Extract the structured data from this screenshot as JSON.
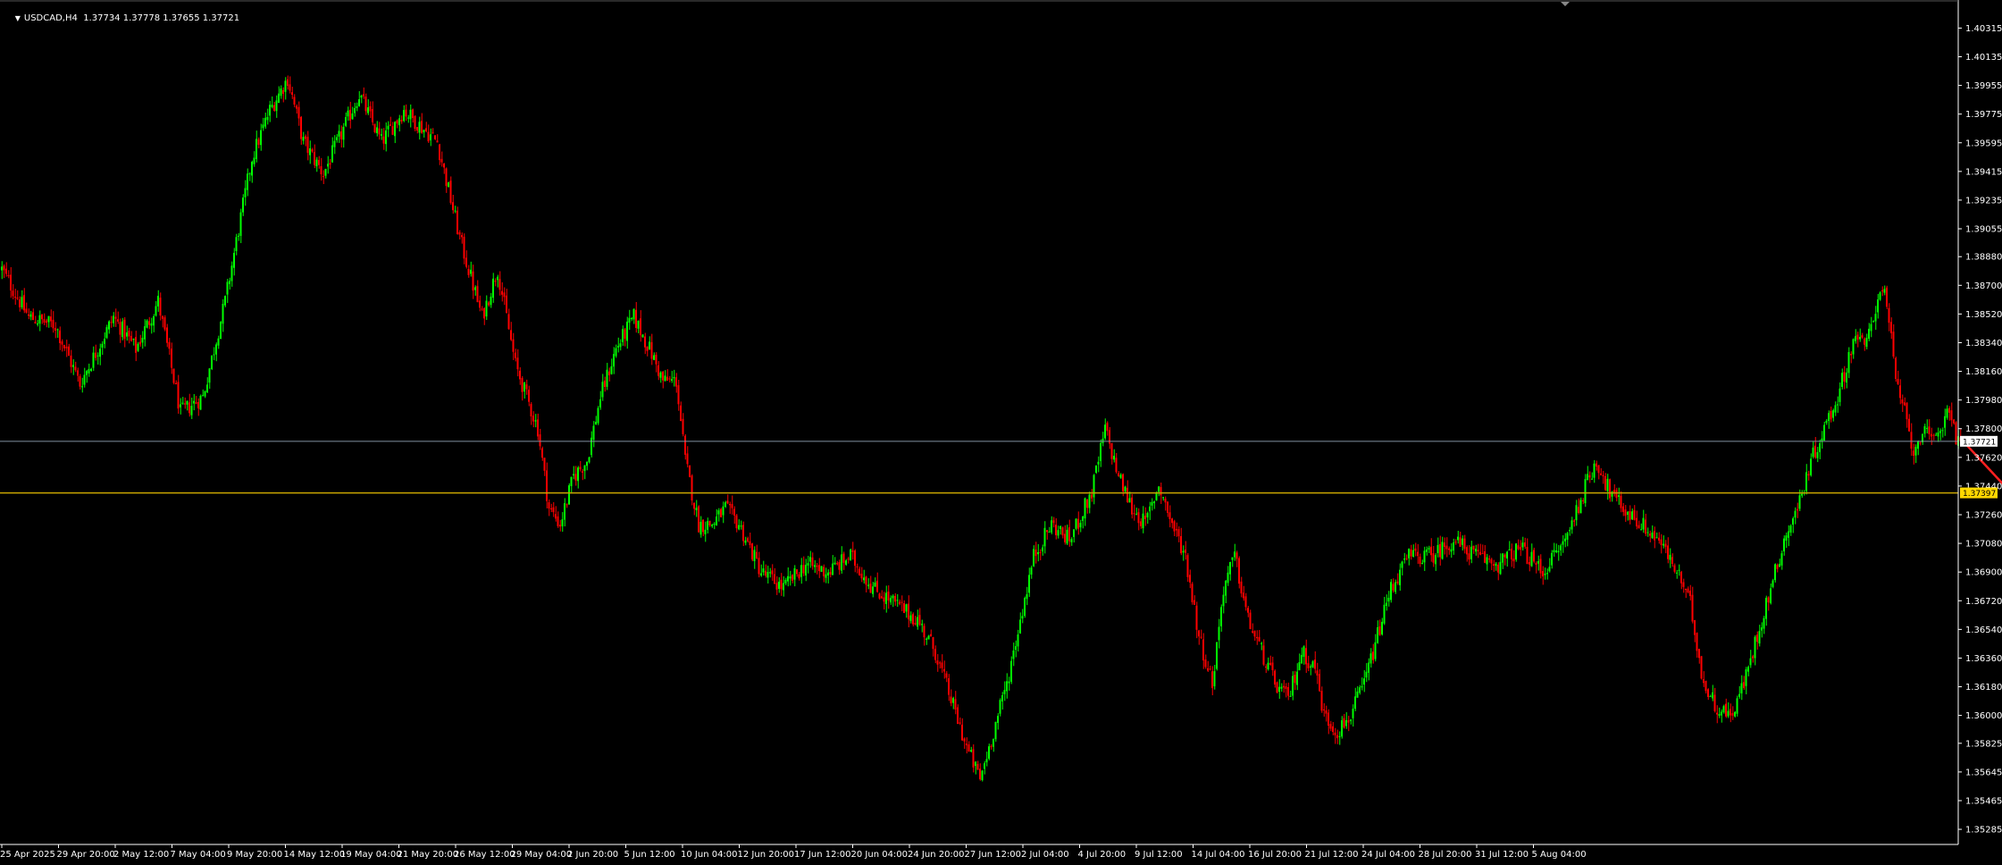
{
  "header": {
    "symbol": "USDCAD,H4",
    "ohlc": "1.37734 1.37778 1.37655 1.37721"
  },
  "colors": {
    "background": "#000000",
    "bull": "#00ff00",
    "bear": "#ff0000",
    "axis": "#ffffff",
    "current_line": "#8090a0",
    "support_line": "#c8a400",
    "projection": "#ff2020",
    "current_label_bg": "#ffffff",
    "support_label_bg": "#ffd700"
  },
  "chart_data": {
    "type": "candlestick",
    "symbol": "USDCAD",
    "timeframe": "H4",
    "ylim": [
      1.3519,
      1.4048
    ],
    "y_ticks": [
      "1.40315",
      "1.40135",
      "1.39955",
      "1.39775",
      "1.39595",
      "1.39415",
      "1.39235",
      "1.39055",
      "1.38880",
      "1.38700",
      "1.38520",
      "1.38340",
      "1.38160",
      "1.37980",
      "1.37800",
      "1.37620",
      "1.37440",
      "1.37260",
      "1.37080",
      "1.36900",
      "1.36720",
      "1.36540",
      "1.36360",
      "1.36180",
      "1.36000",
      "1.35825",
      "1.35645",
      "1.35465",
      "1.35285"
    ],
    "x_ticks": [
      "25 Apr 2025",
      "29 Apr 20:00",
      "2 May 12:00",
      "7 May 04:00",
      "9 May 20:00",
      "14 May 12:00",
      "19 May 04:00",
      "21 May 20:00",
      "26 May 12:00",
      "29 May 04:00",
      "2 Jun 20:00",
      "5 Jun 12:00",
      "10 Jun 04:00",
      "12 Jun 20:00",
      "17 Jun 12:00",
      "20 Jun 04:00",
      "24 Jun 20:00",
      "27 Jun 12:00",
      "2 Jul 04:00",
      "4 Jul 20:00",
      "9 Jul 12:00",
      "14 Jul 04:00",
      "16 Jul 20:00",
      "21 Jul 12:00",
      "24 Jul 04:00",
      "28 Jul 20:00",
      "31 Jul 12:00",
      "5 Aug 04:00"
    ],
    "anchors": [
      [
        0,
        1.388
      ],
      [
        12,
        1.385
      ],
      [
        24,
        1.3845
      ],
      [
        35,
        1.3808
      ],
      [
        50,
        1.385
      ],
      [
        60,
        1.383
      ],
      [
        70,
        1.386
      ],
      [
        80,
        1.379
      ],
      [
        90,
        1.38
      ],
      [
        100,
        1.386
      ],
      [
        108,
        1.392
      ],
      [
        112,
        1.395
      ],
      [
        120,
        1.398
      ],
      [
        128,
        1.4
      ],
      [
        135,
        1.396
      ],
      [
        144,
        1.394
      ],
      [
        160,
        1.399
      ],
      [
        170,
        1.396
      ],
      [
        180,
        1.398
      ],
      [
        195,
        1.396
      ],
      [
        205,
        1.39
      ],
      [
        215,
        1.385
      ],
      [
        222,
        1.388
      ],
      [
        230,
        1.382
      ],
      [
        240,
        1.378
      ],
      [
        245,
        1.373
      ],
      [
        250,
        1.372
      ],
      [
        256,
        1.375
      ],
      [
        262,
        1.376
      ],
      [
        268,
        1.38
      ],
      [
        275,
        1.383
      ],
      [
        283,
        1.385
      ],
      [
        290,
        1.383
      ],
      [
        296,
        1.381
      ],
      [
        302,
        1.381
      ],
      [
        306,
        1.376
      ],
      [
        312,
        1.372
      ],
      [
        318,
        1.372
      ],
      [
        324,
        1.373
      ],
      [
        330,
        1.372
      ],
      [
        340,
        1.369
      ],
      [
        350,
        1.368
      ],
      [
        360,
        1.3695
      ],
      [
        370,
        1.369
      ],
      [
        380,
        1.37
      ],
      [
        390,
        1.368
      ],
      [
        400,
        1.367
      ],
      [
        410,
        1.366
      ],
      [
        418,
        1.364
      ],
      [
        425,
        1.361
      ],
      [
        432,
        1.358
      ],
      [
        438,
        1.356
      ],
      [
        444,
        1.359
      ],
      [
        450,
        1.362
      ],
      [
        456,
        1.366
      ],
      [
        462,
        1.37
      ],
      [
        470,
        1.372
      ],
      [
        478,
        1.371
      ],
      [
        488,
        1.374
      ],
      [
        494,
        1.378
      ],
      [
        500,
        1.375
      ],
      [
        506,
        1.373
      ],
      [
        512,
        1.372
      ],
      [
        518,
        1.3745
      ],
      [
        524,
        1.372
      ],
      [
        530,
        1.37
      ],
      [
        536,
        1.365
      ],
      [
        542,
        1.362
      ],
      [
        547,
        1.368
      ],
      [
        552,
        1.37
      ],
      [
        558,
        1.366
      ],
      [
        564,
        1.364
      ],
      [
        570,
        1.362
      ],
      [
        576,
        1.361
      ],
      [
        582,
        1.364
      ],
      [
        588,
        1.363
      ],
      [
        592,
        1.36
      ],
      [
        598,
        1.359
      ],
      [
        604,
        1.36
      ],
      [
        610,
        1.362
      ],
      [
        616,
        1.365
      ],
      [
        622,
        1.368
      ],
      [
        630,
        1.37
      ],
      [
        640,
        1.37
      ],
      [
        650,
        1.371
      ],
      [
        660,
        1.37
      ],
      [
        670,
        1.3695
      ],
      [
        680,
        1.3705
      ],
      [
        690,
        1.369
      ],
      [
        700,
        1.371
      ],
      [
        708,
        1.374
      ],
      [
        714,
        1.376
      ],
      [
        720,
        1.374
      ],
      [
        726,
        1.373
      ],
      [
        734,
        1.372
      ],
      [
        742,
        1.371
      ],
      [
        750,
        1.369
      ],
      [
        756,
        1.367
      ],
      [
        762,
        1.362
      ],
      [
        768,
        1.3605
      ],
      [
        774,
        1.36
      ],
      [
        780,
        1.362
      ],
      [
        786,
        1.365
      ],
      [
        792,
        1.368
      ],
      [
        798,
        1.371
      ],
      [
        804,
        1.373
      ],
      [
        810,
        1.376
      ],
      [
        816,
        1.378
      ],
      [
        822,
        1.38
      ],
      [
        826,
        1.382
      ],
      [
        830,
        1.384
      ],
      [
        834,
        1.383
      ],
      [
        838,
        1.385
      ],
      [
        841,
        1.387
      ],
      [
        844,
        1.386
      ],
      [
        848,
        1.381
      ],
      [
        852,
        1.379
      ],
      [
        856,
        1.3765
      ],
      [
        860,
        1.378
      ],
      [
        864,
        1.377
      ],
      [
        868,
        1.378
      ],
      [
        872,
        1.3795
      ],
      [
        875,
        1.3775
      ],
      [
        877,
        1.3772
      ]
    ],
    "current_price": "1.37721",
    "support_level": "1.37397",
    "projection": {
      "from": [
        877,
        1.37721
      ],
      "to": [
        897,
        1.3742
      ]
    }
  }
}
